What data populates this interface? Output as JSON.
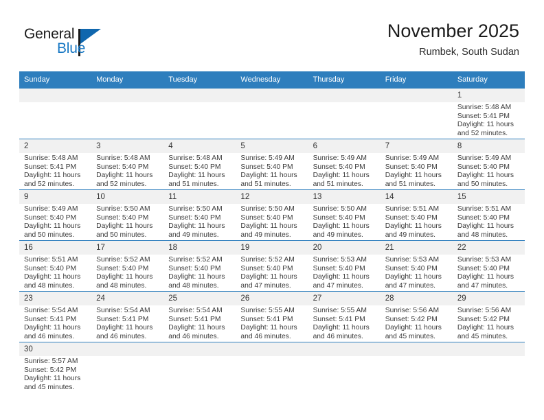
{
  "brand": {
    "name_part1": "General",
    "name_part2": "Blue",
    "accent_color": "#1878c4"
  },
  "header": {
    "title": "November 2025",
    "location": "Rumbek, South Sudan"
  },
  "calendar": {
    "header_bg": "#2e7ebd",
    "weekdays": [
      "Sunday",
      "Monday",
      "Tuesday",
      "Wednesday",
      "Thursday",
      "Friday",
      "Saturday"
    ],
    "weeks": [
      [
        {
          "day": "",
          "lines": []
        },
        {
          "day": "",
          "lines": []
        },
        {
          "day": "",
          "lines": []
        },
        {
          "day": "",
          "lines": []
        },
        {
          "day": "",
          "lines": []
        },
        {
          "day": "",
          "lines": []
        },
        {
          "day": "1",
          "lines": [
            "Sunrise: 5:48 AM",
            "Sunset: 5:41 PM",
            "Daylight: 11 hours and 52 minutes."
          ]
        }
      ],
      [
        {
          "day": "2",
          "lines": [
            "Sunrise: 5:48 AM",
            "Sunset: 5:41 PM",
            "Daylight: 11 hours and 52 minutes."
          ]
        },
        {
          "day": "3",
          "lines": [
            "Sunrise: 5:48 AM",
            "Sunset: 5:40 PM",
            "Daylight: 11 hours and 52 minutes."
          ]
        },
        {
          "day": "4",
          "lines": [
            "Sunrise: 5:48 AM",
            "Sunset: 5:40 PM",
            "Daylight: 11 hours and 51 minutes."
          ]
        },
        {
          "day": "5",
          "lines": [
            "Sunrise: 5:49 AM",
            "Sunset: 5:40 PM",
            "Daylight: 11 hours and 51 minutes."
          ]
        },
        {
          "day": "6",
          "lines": [
            "Sunrise: 5:49 AM",
            "Sunset: 5:40 PM",
            "Daylight: 11 hours and 51 minutes."
          ]
        },
        {
          "day": "7",
          "lines": [
            "Sunrise: 5:49 AM",
            "Sunset: 5:40 PM",
            "Daylight: 11 hours and 51 minutes."
          ]
        },
        {
          "day": "8",
          "lines": [
            "Sunrise: 5:49 AM",
            "Sunset: 5:40 PM",
            "Daylight: 11 hours and 50 minutes."
          ]
        }
      ],
      [
        {
          "day": "9",
          "lines": [
            "Sunrise: 5:49 AM",
            "Sunset: 5:40 PM",
            "Daylight: 11 hours and 50 minutes."
          ]
        },
        {
          "day": "10",
          "lines": [
            "Sunrise: 5:50 AM",
            "Sunset: 5:40 PM",
            "Daylight: 11 hours and 50 minutes."
          ]
        },
        {
          "day": "11",
          "lines": [
            "Sunrise: 5:50 AM",
            "Sunset: 5:40 PM",
            "Daylight: 11 hours and 49 minutes."
          ]
        },
        {
          "day": "12",
          "lines": [
            "Sunrise: 5:50 AM",
            "Sunset: 5:40 PM",
            "Daylight: 11 hours and 49 minutes."
          ]
        },
        {
          "day": "13",
          "lines": [
            "Sunrise: 5:50 AM",
            "Sunset: 5:40 PM",
            "Daylight: 11 hours and 49 minutes."
          ]
        },
        {
          "day": "14",
          "lines": [
            "Sunrise: 5:51 AM",
            "Sunset: 5:40 PM",
            "Daylight: 11 hours and 49 minutes."
          ]
        },
        {
          "day": "15",
          "lines": [
            "Sunrise: 5:51 AM",
            "Sunset: 5:40 PM",
            "Daylight: 11 hours and 48 minutes."
          ]
        }
      ],
      [
        {
          "day": "16",
          "lines": [
            "Sunrise: 5:51 AM",
            "Sunset: 5:40 PM",
            "Daylight: 11 hours and 48 minutes."
          ]
        },
        {
          "day": "17",
          "lines": [
            "Sunrise: 5:52 AM",
            "Sunset: 5:40 PM",
            "Daylight: 11 hours and 48 minutes."
          ]
        },
        {
          "day": "18",
          "lines": [
            "Sunrise: 5:52 AM",
            "Sunset: 5:40 PM",
            "Daylight: 11 hours and 48 minutes."
          ]
        },
        {
          "day": "19",
          "lines": [
            "Sunrise: 5:52 AM",
            "Sunset: 5:40 PM",
            "Daylight: 11 hours and 47 minutes."
          ]
        },
        {
          "day": "20",
          "lines": [
            "Sunrise: 5:53 AM",
            "Sunset: 5:40 PM",
            "Daylight: 11 hours and 47 minutes."
          ]
        },
        {
          "day": "21",
          "lines": [
            "Sunrise: 5:53 AM",
            "Sunset: 5:40 PM",
            "Daylight: 11 hours and 47 minutes."
          ]
        },
        {
          "day": "22",
          "lines": [
            "Sunrise: 5:53 AM",
            "Sunset: 5:40 PM",
            "Daylight: 11 hours and 47 minutes."
          ]
        }
      ],
      [
        {
          "day": "23",
          "lines": [
            "Sunrise: 5:54 AM",
            "Sunset: 5:41 PM",
            "Daylight: 11 hours and 46 minutes."
          ]
        },
        {
          "day": "24",
          "lines": [
            "Sunrise: 5:54 AM",
            "Sunset: 5:41 PM",
            "Daylight: 11 hours and 46 minutes."
          ]
        },
        {
          "day": "25",
          "lines": [
            "Sunrise: 5:54 AM",
            "Sunset: 5:41 PM",
            "Daylight: 11 hours and 46 minutes."
          ]
        },
        {
          "day": "26",
          "lines": [
            "Sunrise: 5:55 AM",
            "Sunset: 5:41 PM",
            "Daylight: 11 hours and 46 minutes."
          ]
        },
        {
          "day": "27",
          "lines": [
            "Sunrise: 5:55 AM",
            "Sunset: 5:41 PM",
            "Daylight: 11 hours and 46 minutes."
          ]
        },
        {
          "day": "28",
          "lines": [
            "Sunrise: 5:56 AM",
            "Sunset: 5:42 PM",
            "Daylight: 11 hours and 45 minutes."
          ]
        },
        {
          "day": "29",
          "lines": [
            "Sunrise: 5:56 AM",
            "Sunset: 5:42 PM",
            "Daylight: 11 hours and 45 minutes."
          ]
        }
      ],
      [
        {
          "day": "30",
          "lines": [
            "Sunrise: 5:57 AM",
            "Sunset: 5:42 PM",
            "Daylight: 11 hours and 45 minutes."
          ]
        },
        {
          "day": "",
          "lines": []
        },
        {
          "day": "",
          "lines": []
        },
        {
          "day": "",
          "lines": []
        },
        {
          "day": "",
          "lines": []
        },
        {
          "day": "",
          "lines": []
        },
        {
          "day": "",
          "lines": []
        }
      ]
    ]
  }
}
